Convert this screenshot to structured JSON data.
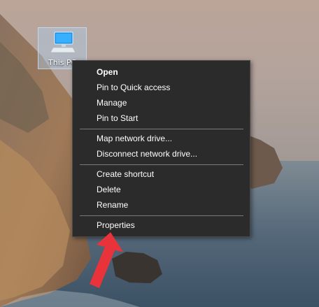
{
  "desktop": {
    "icon": {
      "label": "This PC",
      "icon_name": "computer-monitor-icon",
      "selected": true
    },
    "highlight_arrow": {
      "icon_name": "red-arrow-pointer",
      "color": "#e8333a",
      "points_to": "Properties"
    }
  },
  "context_menu": {
    "groups": [
      [
        {
          "label": "Open",
          "default": true
        },
        {
          "label": "Pin to Quick access"
        },
        {
          "label": "Manage"
        },
        {
          "label": "Pin to Start"
        }
      ],
      [
        {
          "label": "Map network drive..."
        },
        {
          "label": "Disconnect network drive..."
        }
      ],
      [
        {
          "label": "Create shortcut"
        },
        {
          "label": "Delete"
        },
        {
          "label": "Rename"
        }
      ],
      [
        {
          "label": "Properties"
        }
      ]
    ]
  },
  "colors": {
    "menu_background": "#2b2b2b",
    "menu_text": "#ffffff",
    "separator": "#7a7a7a",
    "selection_fill": "#adceee",
    "arrow": "#e8333a"
  }
}
